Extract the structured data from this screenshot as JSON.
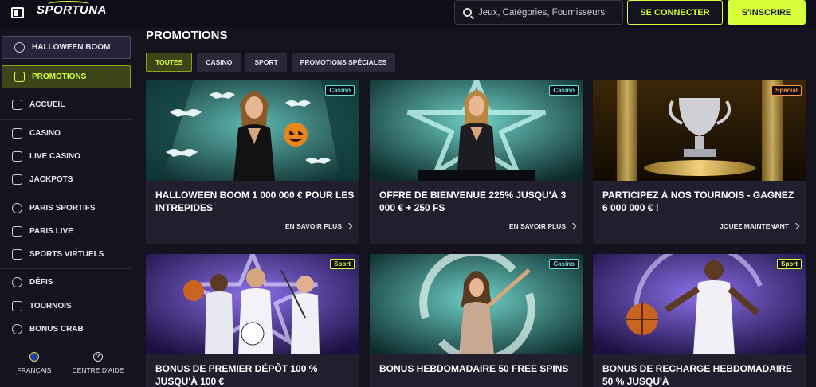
{
  "header": {
    "logo": "SPORTUNA",
    "search_placeholder": "Jeux, Catégories, Fournisseurs",
    "login_label": "SE CONNECTER",
    "register_label": "S'INSCRIRE"
  },
  "sidebar": {
    "items": [
      {
        "label": "HALLOWEEN BOOM",
        "icon": "pumpkin-icon"
      },
      {
        "label": "PROMOTIONS",
        "icon": "gift-icon"
      },
      {
        "label": "ACCUEIL",
        "icon": "home-icon"
      },
      {
        "label": "CASINO",
        "icon": "slot-machine-icon"
      },
      {
        "label": "LIVE CASINO",
        "icon": "live-cards-icon"
      },
      {
        "label": "JACKPOTS",
        "icon": "jackpot-icon"
      },
      {
        "label": "PARIS SPORTIFS",
        "icon": "soccer-ball-icon"
      },
      {
        "label": "PARIS LIVE",
        "icon": "video-icon"
      },
      {
        "label": "SPORTS VIRTUELS",
        "icon": "gamepad-icon"
      },
      {
        "label": "DÉFIS",
        "icon": "medal-icon"
      },
      {
        "label": "TOURNOIS",
        "icon": "trophy-icon"
      },
      {
        "label": "BONUS CRAB",
        "icon": "crab-icon"
      }
    ],
    "footer": {
      "language_label": "FRANÇAIS",
      "help_label": "CENTRE D'AIDE"
    }
  },
  "main": {
    "title": "PROMOTIONS",
    "tabs": [
      {
        "label": "TOUTES",
        "active": true
      },
      {
        "label": "CASINO",
        "active": false
      },
      {
        "label": "SPORT",
        "active": false
      },
      {
        "label": "PROMOTIONS SPÉCIALES",
        "active": false
      }
    ],
    "cards": [
      {
        "badge": "Casino",
        "title": "HALLOWEEN BOOM 1 000 000 € POUR LES INTREPIDES",
        "link": "EN SAVOIR PLUS"
      },
      {
        "badge": "Casino",
        "title": "OFFRE DE BIENVENUE 225% JUSQU'À 3 000 € + 250 FS",
        "link": "EN SAVOIR PLUS"
      },
      {
        "badge": "Spécial",
        "title": "PARTICIPEZ À NOS TOURNOIS - GAGNEZ 6 000 000 € !",
        "link": "JOUEZ MAINTENANT"
      },
      {
        "badge": "Sport",
        "title": "BONUS DE PREMIER DÉPÔT 100 % JUSQU'À 100 €",
        "link": ""
      },
      {
        "badge": "Casino",
        "title": "BONUS HEBDOMADAIRE 50 FREE SPINS",
        "link": ""
      },
      {
        "badge": "Sport",
        "title": "BONUS DE RECHARGE HEBDOMADAIRE 50 % JUSQU'À",
        "link": ""
      }
    ]
  },
  "colors": {
    "accent": "#d8ff3c",
    "background": "#14121d",
    "card": "#211e2d",
    "casino_badge": "#66e0d6",
    "special_badge": "#ff9a3c"
  }
}
